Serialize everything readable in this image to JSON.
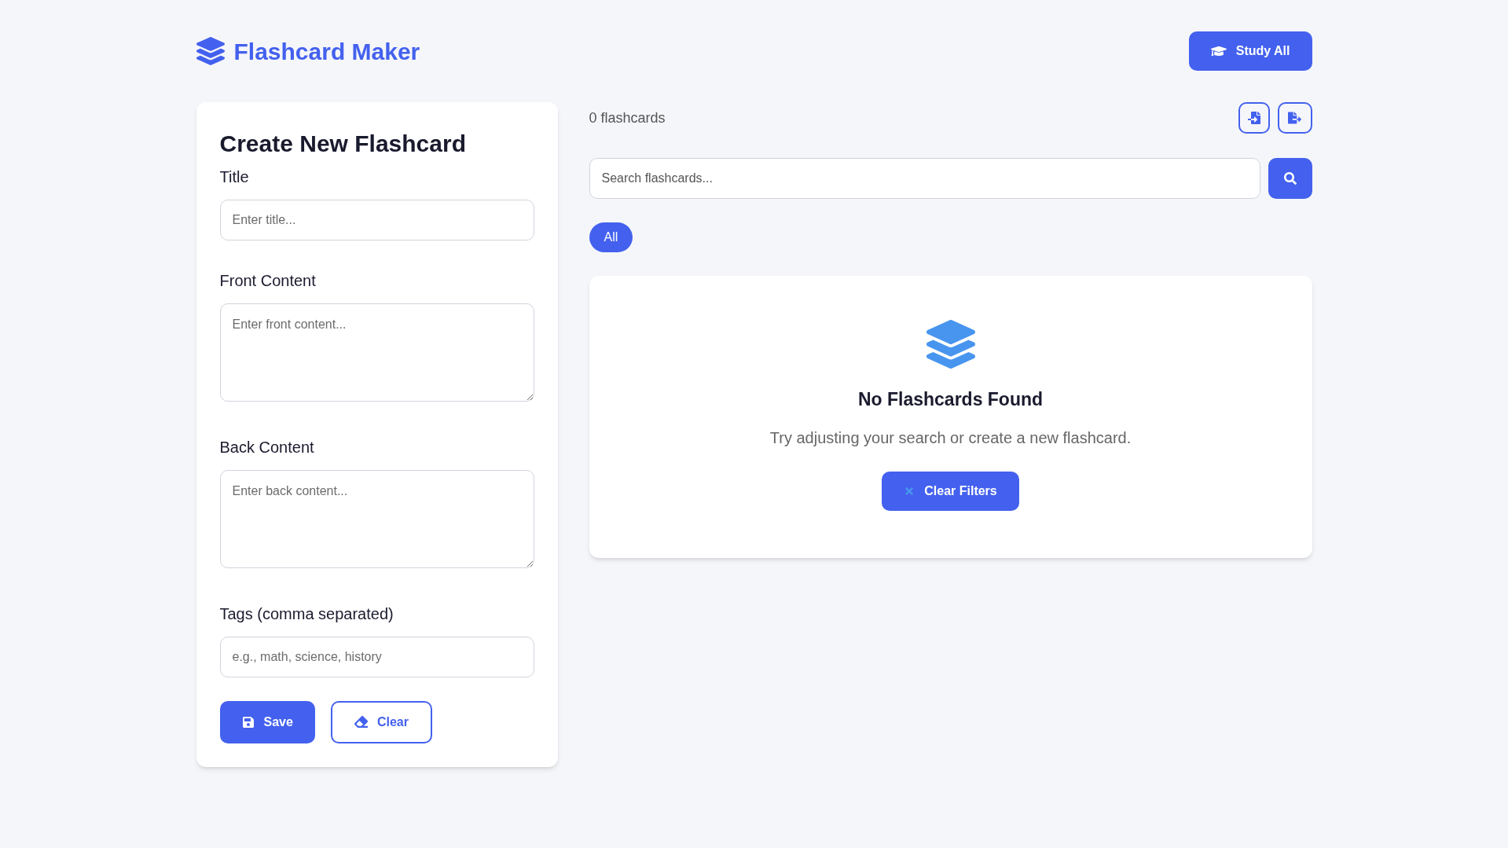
{
  "header": {
    "title": "Flashcard Maker",
    "study_button": "Study All"
  },
  "form": {
    "heading": "Create New Flashcard",
    "fields": [
      {
        "kind": "input",
        "label": "Title",
        "placeholder": "Enter title..."
      },
      {
        "kind": "textarea",
        "label": "Front Content",
        "placeholder": "Enter front content..."
      },
      {
        "kind": "textarea",
        "label": "Back Content",
        "placeholder": "Enter back content..."
      },
      {
        "kind": "input",
        "label": "Tags (comma separated)",
        "placeholder": "e.g., math, science, history"
      }
    ],
    "save_button": "Save",
    "clear_button": "Clear"
  },
  "list": {
    "count": "0 flashcards",
    "search": {
      "placeholder": "Search flashcards..."
    },
    "filters": [
      {
        "label": "All",
        "selected": true
      }
    ],
    "empty_state": {
      "title": "No Flashcards Found",
      "message": "Try adjusting your search or create a new flashcard.",
      "button": "Clear Filters"
    }
  }
}
